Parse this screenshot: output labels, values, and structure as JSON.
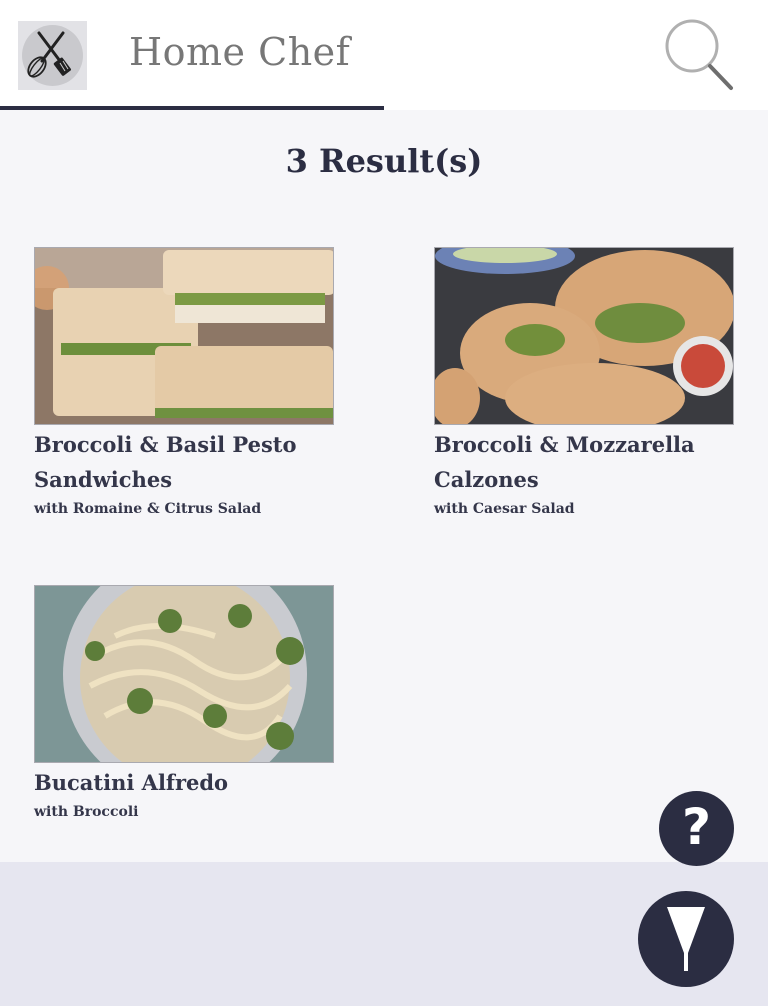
{
  "header": {
    "app_title": "Home Chef",
    "logo_icon": "whisk-spatula-icon",
    "search_icon": "search-icon"
  },
  "results": {
    "heading": "3 Result(s)"
  },
  "recipes": [
    {
      "title_line1": "Broccoli & Basil Pesto",
      "title_line2": "Sandwiches",
      "subtitle": "with Romaine & Citrus Salad",
      "image": "sandwich-photo"
    },
    {
      "title_line1": "Broccoli & Mozzarella",
      "title_line2": "Calzones",
      "subtitle": "with Caesar Salad",
      "image": "calzone-photo"
    },
    {
      "title_line1": "Bucatini Alfredo",
      "subtitle": "with Broccoli",
      "image": "pasta-photo"
    }
  ],
  "floating": {
    "help_label": "?",
    "help_icon": "help-icon",
    "filter_icon": "filter-icon"
  },
  "colors": {
    "accent": "#2b2d42",
    "background": "#f6f6f9",
    "footer": "#e6e6f0"
  }
}
